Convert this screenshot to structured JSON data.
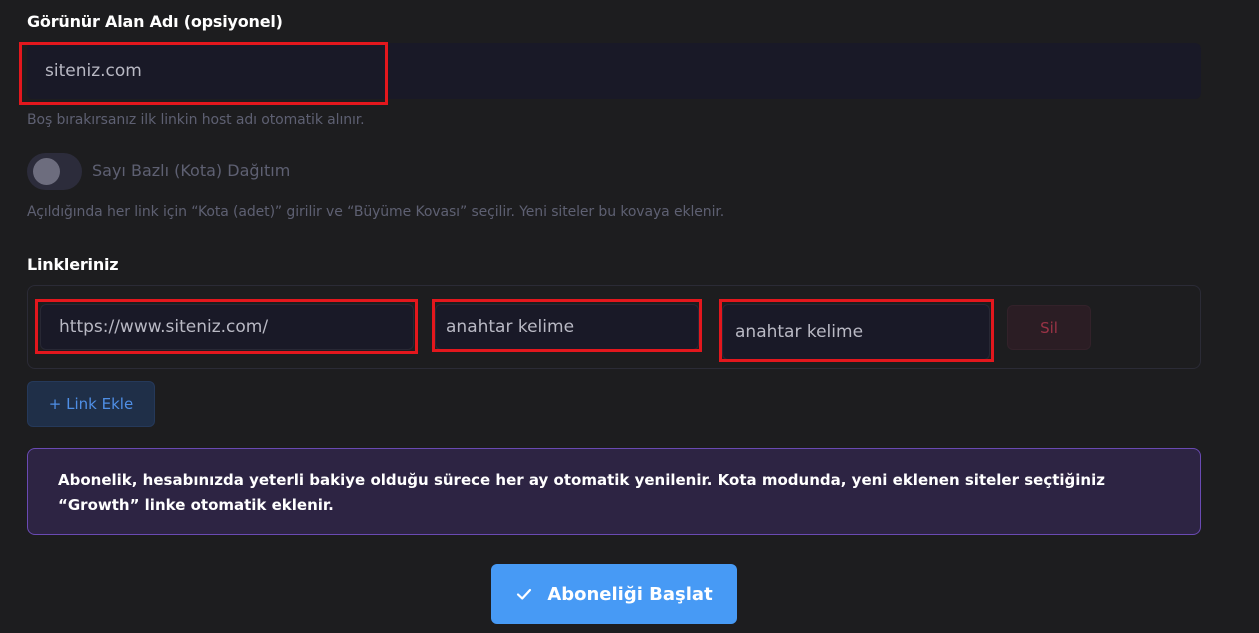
{
  "domain": {
    "label": "Görünür Alan Adı (opsiyonel)",
    "placeholder": "siteniz.com",
    "value": "",
    "hint": "Boş bırakırsanız ilk linkin host adı otomatik alınır."
  },
  "quota": {
    "toggle_label": "Sayı Bazlı (Kota) Dağıtım",
    "enabled": false,
    "hint": "Açıldığında her link için “Kota (adet)” girilir ve “Büyüme Kovası” seçilir. Yeni siteler bu kovaya eklenir."
  },
  "links": {
    "label": "Linkleriniz",
    "rows": [
      {
        "url_placeholder": "https://www.siteniz.com/",
        "keyword1_placeholder": "anahtar kelime",
        "keyword2_placeholder": "anahtar kelime",
        "delete_label": "Sil"
      }
    ],
    "add_label": "+ Link Ekle"
  },
  "info": {
    "text": "Abonelik, hesabınızda yeterli bakiye olduğu sürece her ay otomatik yenilenir. Kota modunda, yeni eklenen siteler seçtiğiniz “Growth” linke otomatik eklenir."
  },
  "submit": {
    "label": "Aboneliği Başlat",
    "icon": "check-icon"
  },
  "colors": {
    "background": "#1d1d1f",
    "input_bg": "#191927",
    "highlight": "#e3171d",
    "primary": "#479af5",
    "info_border": "#6a4ab3",
    "danger_text": "#9a3346"
  }
}
